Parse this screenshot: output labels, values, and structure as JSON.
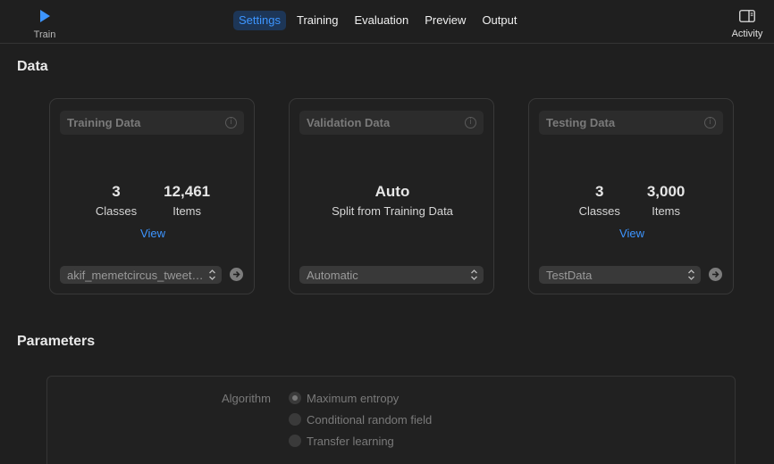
{
  "toolbar": {
    "train_label": "Train",
    "activity_label": "Activity",
    "tabs": [
      {
        "label": "Settings",
        "active": true
      },
      {
        "label": "Training",
        "active": false
      },
      {
        "label": "Evaluation",
        "active": false
      },
      {
        "label": "Preview",
        "active": false
      },
      {
        "label": "Output",
        "active": false
      }
    ]
  },
  "data_section": {
    "title": "Data",
    "cards": [
      {
        "title": "Training Data",
        "stats": [
          {
            "value": "3",
            "label": "Classes"
          },
          {
            "value": "12,461",
            "label": "Items"
          }
        ],
        "link": "View",
        "picker": "akif_memetcircus_tweet…"
      },
      {
        "title": "Validation Data",
        "value": "Auto",
        "caption": "Split from Training Data",
        "picker": "Automatic"
      },
      {
        "title": "Testing Data",
        "stats": [
          {
            "value": "3",
            "label": "Classes"
          },
          {
            "value": "3,000",
            "label": "Items"
          }
        ],
        "link": "View",
        "picker": "TestData"
      }
    ]
  },
  "parameters": {
    "title": "Parameters",
    "algorithm_label": "Algorithm",
    "options": [
      {
        "label": "Maximum entropy",
        "selected": true
      },
      {
        "label": "Conditional random field",
        "selected": false
      },
      {
        "label": "Transfer learning",
        "selected": false
      }
    ]
  },
  "colors": {
    "accent": "#3d95ff",
    "background": "#1f1f1f",
    "card_border": "#383838"
  },
  "icons": [
    "play-icon",
    "sidebar-icon",
    "info-icon",
    "chevron-updown-icon",
    "arrow-right-circle-icon"
  ]
}
